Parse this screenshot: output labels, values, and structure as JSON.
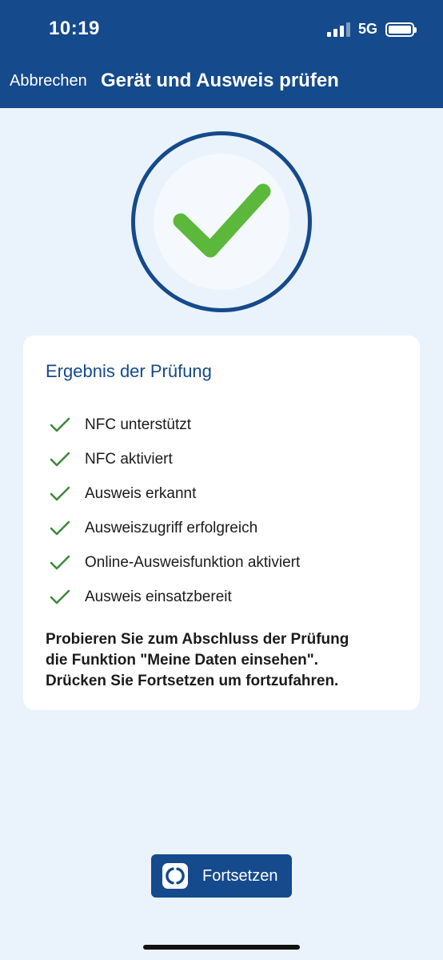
{
  "status_bar": {
    "time": "10:19",
    "network": "5G",
    "icons": [
      "signal-icon",
      "battery-icon"
    ]
  },
  "nav": {
    "cancel_label": "Abbrechen",
    "title": "Gerät und Ausweis prüfen"
  },
  "result_icon": "checkmark-success-icon",
  "card": {
    "title": "Ergebnis der Prüfung",
    "items": [
      "NFC unterstützt",
      "NFC aktiviert",
      "Ausweis erkannt",
      "Ausweiszugriff erfolgreich",
      "Online-Ausweisfunktion aktiviert",
      "Ausweis einsatzbereit"
    ],
    "note_lines": [
      "Probieren Sie zum Abschluss der Prüfung",
      "die Funktion \"Meine Daten einsehen\".",
      "Drücken Sie Fortsetzen um fortzufahren."
    ]
  },
  "continue_button": {
    "label": "Fortsetzen",
    "icon": "ausweisapp-icon"
  },
  "colors": {
    "primary": "#154a8c",
    "background": "#eaf2fb",
    "success": "#5cb83a",
    "check_item": "#3d8a3d"
  }
}
